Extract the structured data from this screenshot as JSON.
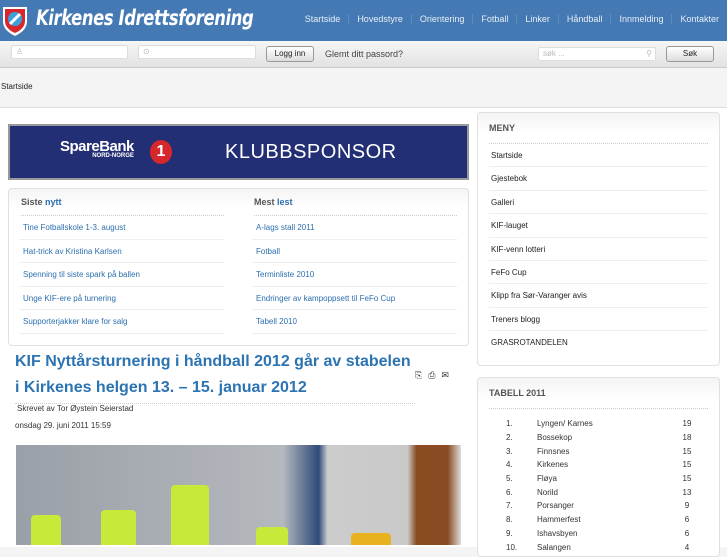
{
  "header": {
    "site_title": "Kirkenes Idrettsforening",
    "nav": [
      "Startside",
      "Hovedstyre",
      "Orientering",
      "Fotball",
      "Linker",
      "Håndball",
      "Innmelding",
      "Kontakter"
    ],
    "brand_color": "#4479b3"
  },
  "login": {
    "login_button": "Logg inn",
    "forgot": "Glemt ditt passord?",
    "search_placeholder": "søk ...",
    "search_button": "Søk"
  },
  "breadcrumb": "Startside",
  "banner": {
    "bank": "SpareBank",
    "region": "NORD-NORGE",
    "badge": "1",
    "text": "KLUBBSPONSOR"
  },
  "latest": {
    "title_a": "Siste",
    "title_b": "nytt",
    "items": [
      "Tine Fotballskole 1-3. august",
      "Hat-trick av Kristina Karlsen",
      "Spenning til siste spark på ballen",
      "Unge KIF-ere på turnering",
      "Supporterjakker klare for salg"
    ]
  },
  "popular": {
    "title_a": "Mest",
    "title_b": "lest",
    "items": [
      "A-lags stall 2011",
      "Fotball",
      "Terminliste 2010",
      "Endringer av kampoppsett til FeFo Cup",
      "Tabell 2010"
    ]
  },
  "article": {
    "title": "KIF Nyttårsturnering i håndball 2012 går av stabelen i Kirkenes helgen 13. – 15. januar 2012",
    "author": "Skrevet av Tor Øystein Seierstad",
    "date": "onsdag 29. juni 2011 15:59"
  },
  "menu": {
    "title": "MENY",
    "items": [
      "Startside",
      "Gjestebok",
      "Galleri",
      "KIF-lauget",
      "KIF-venn lotteri",
      "FeFo Cup",
      "Klipp fra Sør-Varanger avis",
      "Treners blogg",
      "GRASROTANDELEN"
    ]
  },
  "table": {
    "title": "TABELL 2011",
    "rows": [
      [
        "1.",
        "Lyngen/ Karnes",
        "19"
      ],
      [
        "2.",
        "Bossekop",
        "18"
      ],
      [
        "3.",
        "Finnsnes",
        "15"
      ],
      [
        "4.",
        "Kirkenes",
        "15"
      ],
      [
        "5.",
        "Fløya",
        "15"
      ],
      [
        "6.",
        "Norild",
        "13"
      ],
      [
        "7.",
        "Porsanger",
        "9"
      ],
      [
        "8.",
        "Hammerfest",
        "6"
      ],
      [
        "9.",
        "Ishavsbyen",
        "6"
      ],
      [
        "10.",
        "Salangen",
        "4"
      ]
    ]
  }
}
